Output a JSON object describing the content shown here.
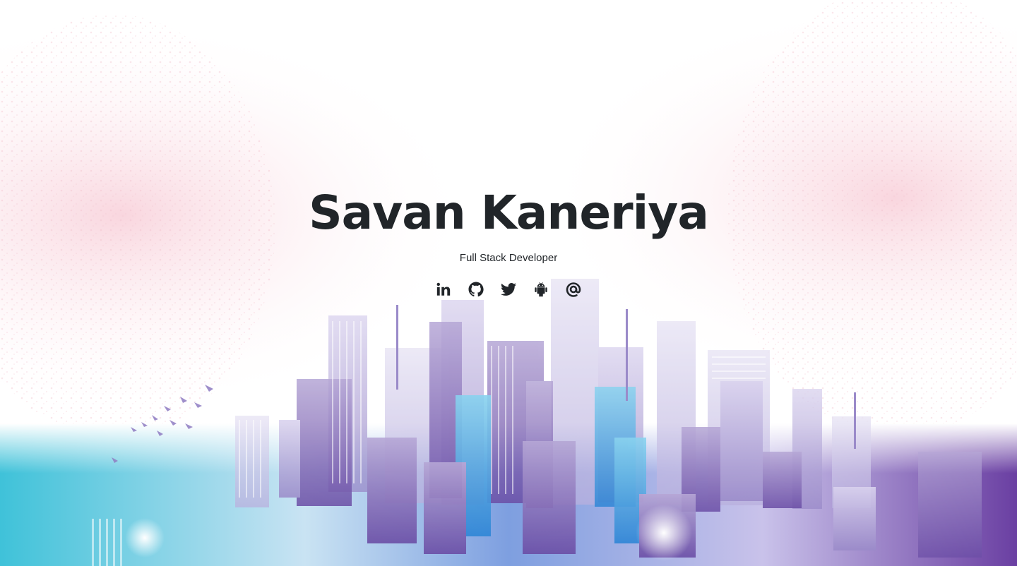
{
  "hero": {
    "name": "Savan Kaneriya",
    "role": "Full Stack Developer"
  },
  "social_links": [
    {
      "icon": "linkedin-icon"
    },
    {
      "icon": "github-icon"
    },
    {
      "icon": "twitter-icon"
    },
    {
      "icon": "android-icon"
    },
    {
      "icon": "email-at-icon"
    }
  ],
  "colors": {
    "text": "#212529",
    "cyan_accent": "#35b9d8",
    "purple_accent": "#6b4ea6",
    "pink_speckle": "#f6c9d3"
  }
}
